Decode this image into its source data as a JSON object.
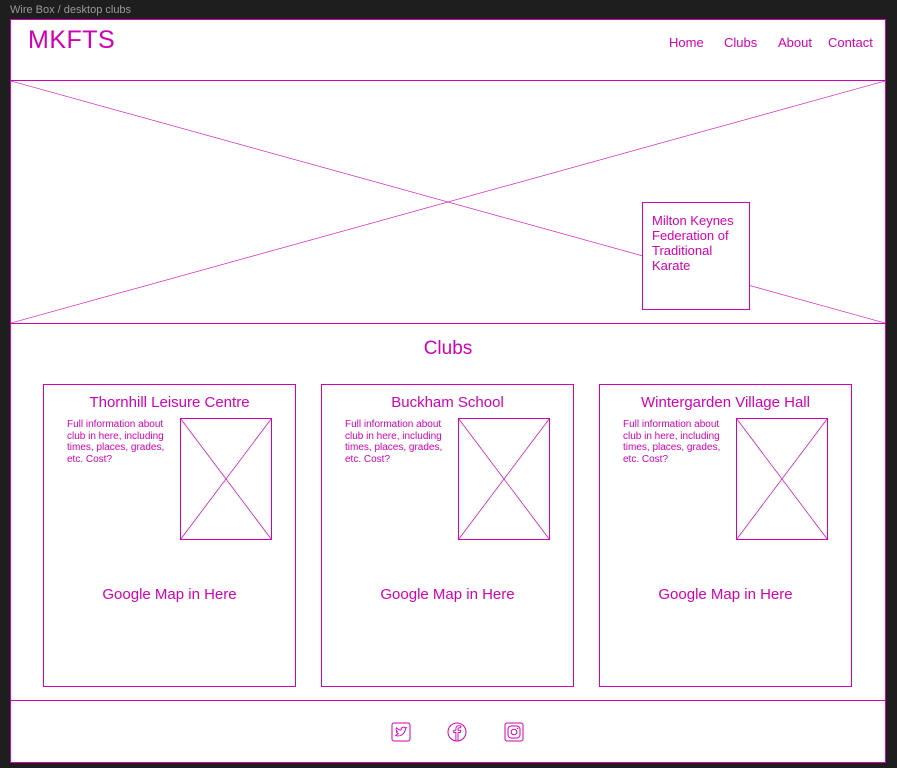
{
  "frame": {
    "label": "Wire Box / desktop clubs"
  },
  "header": {
    "logo": "MKFTS",
    "nav": [
      "Home",
      "Clubs",
      "About",
      "Contact"
    ]
  },
  "hero": {
    "caption": "Milton Keynes Federation of Traditional Karate"
  },
  "clubs": {
    "title": "Clubs",
    "cards": [
      {
        "name": "Thornhill Leisure Centre",
        "info": "Full information about club in here, including times, places, grades, etc. Cost?",
        "map": "Google Map in Here"
      },
      {
        "name": "Buckham School",
        "info": "Full information about club in here, including times, places, grades, etc. Cost?",
        "map": "Google Map in Here"
      },
      {
        "name": "Wintergarden Village Hall",
        "info": "Full information about club in here, including times, places, grades, etc. Cost?",
        "map": "Google Map in Here"
      }
    ]
  },
  "footer": {
    "icons": [
      "twitter-icon",
      "facebook-icon",
      "instagram-icon"
    ]
  },
  "colors": {
    "accent": "#d200b4",
    "background": "#1e1e1e",
    "frame": "#ffffff"
  }
}
